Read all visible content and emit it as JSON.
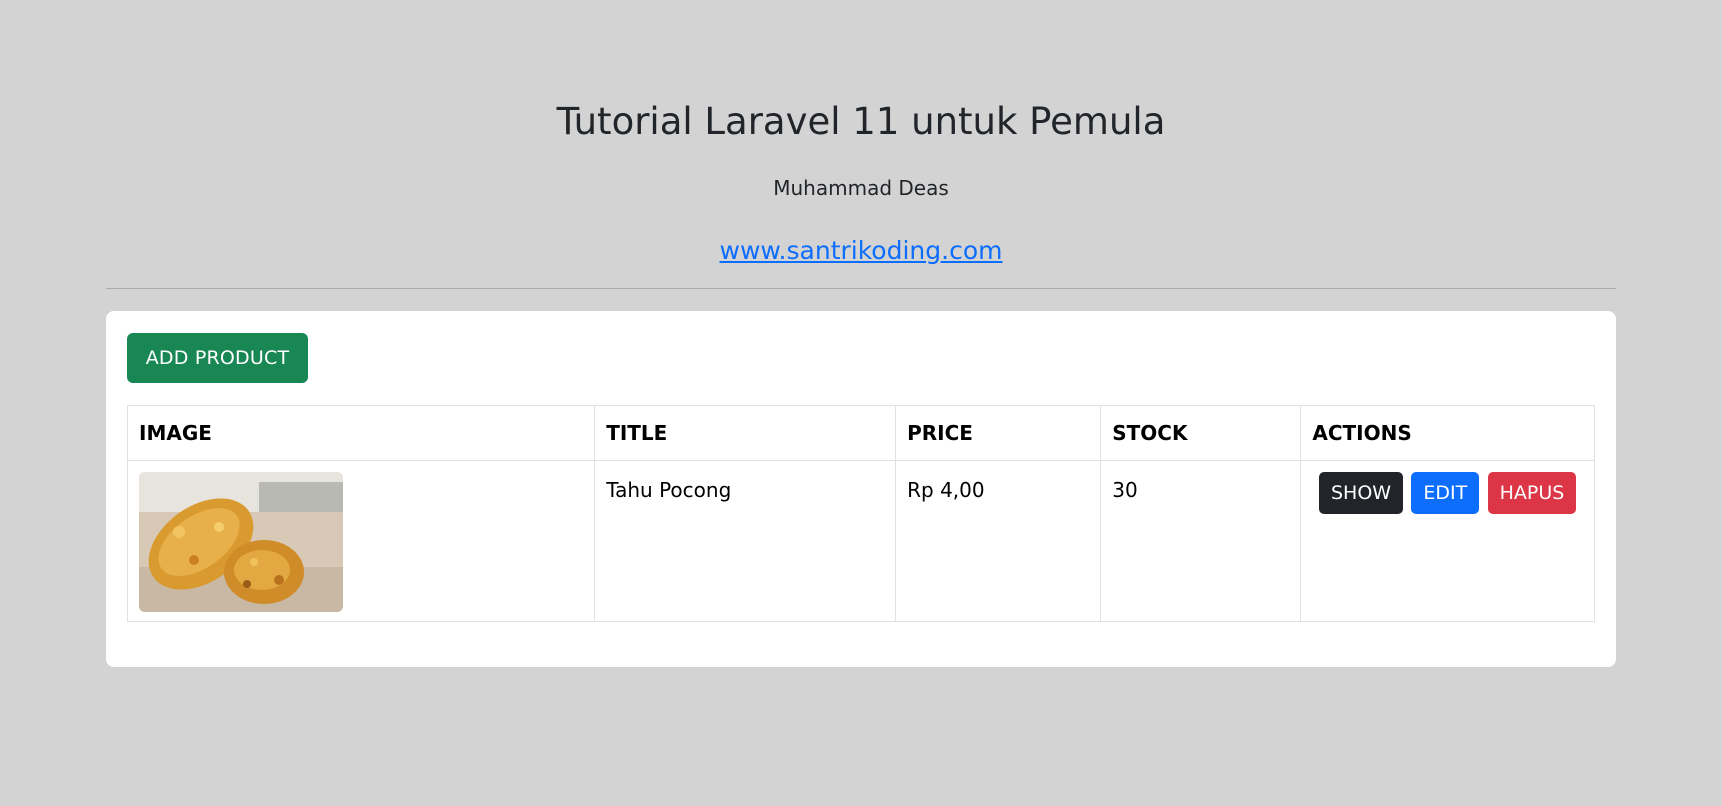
{
  "header": {
    "title": "Tutorial Laravel 11 untuk Pemula",
    "author": "Muhammad Deas",
    "link_text": "www.santrikoding.com"
  },
  "toolbar": {
    "add_label": "ADD PRODUCT"
  },
  "table": {
    "columns": [
      "IMAGE",
      "TITLE",
      "PRICE",
      "STOCK",
      "ACTIONS"
    ],
    "rows": [
      {
        "title": "Tahu Pocong",
        "price": "Rp 4,00",
        "stock": "30",
        "actions": {
          "show": "SHOW",
          "edit": "EDIT",
          "delete": "HAPUS"
        }
      }
    ]
  },
  "colors": {
    "background": "#d3d3d3",
    "add_button": "#198754",
    "show_button": "#212529",
    "edit_button": "#0d6efd",
    "delete_button": "#dc3545",
    "link": "#0d6efd"
  }
}
